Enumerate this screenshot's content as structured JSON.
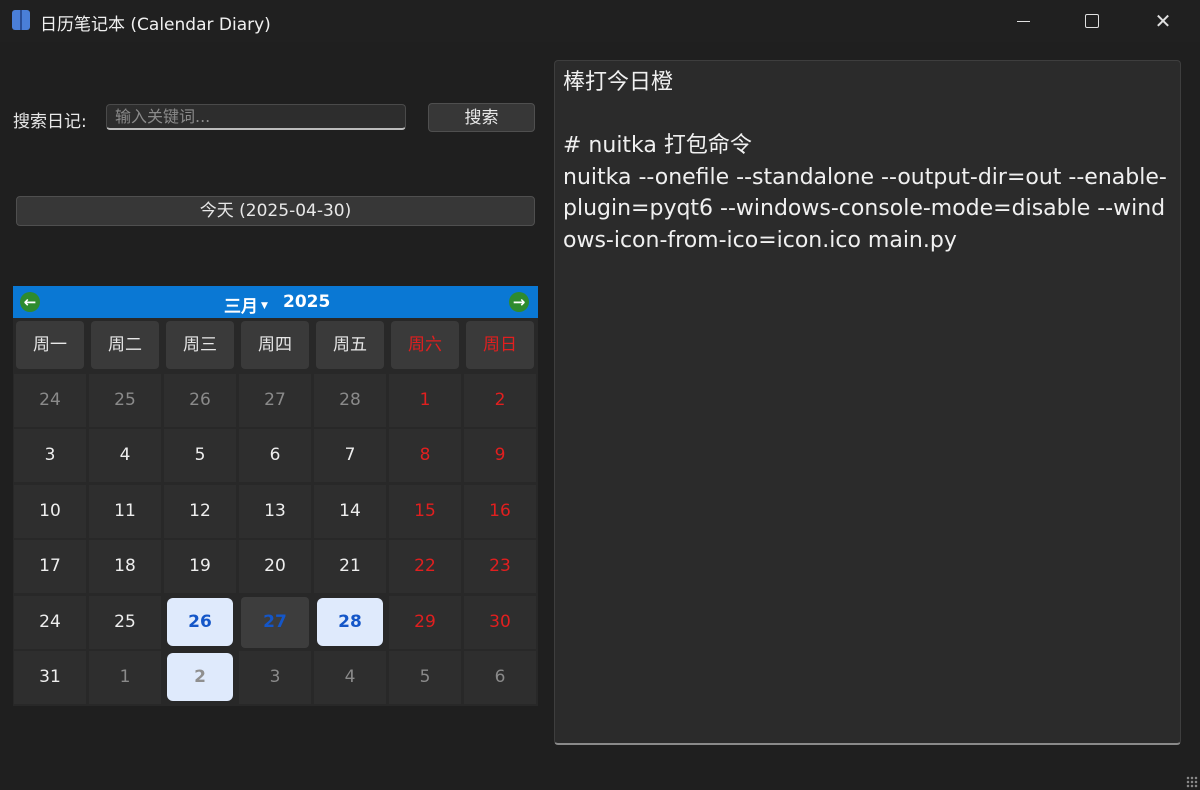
{
  "window": {
    "title": "日历笔记本 (Calendar Diary)",
    "icon": "book-icon",
    "controls": {
      "minimize": "minimize-icon",
      "maximize": "maximize-icon",
      "close": "✕"
    }
  },
  "search": {
    "label": "搜索日记:",
    "placeholder": "输入关键词...",
    "value": "",
    "button_label": "搜索"
  },
  "today_button": "今天 (2025-04-30)",
  "calendar": {
    "month": "三月",
    "year": "2025",
    "prev_icon": "←",
    "next_icon": "→",
    "weekdays": [
      "周一",
      "周二",
      "周三",
      "周四",
      "周五",
      "周六",
      "周日"
    ],
    "weeks": [
      [
        {
          "d": "24",
          "s": "other"
        },
        {
          "d": "25",
          "s": "other"
        },
        {
          "d": "26",
          "s": "other"
        },
        {
          "d": "27",
          "s": "other"
        },
        {
          "d": "28",
          "s": "other"
        },
        {
          "d": "1",
          "s": "weekend"
        },
        {
          "d": "2",
          "s": "weekend"
        }
      ],
      [
        {
          "d": "3",
          "s": ""
        },
        {
          "d": "4",
          "s": ""
        },
        {
          "d": "5",
          "s": ""
        },
        {
          "d": "6",
          "s": ""
        },
        {
          "d": "7",
          "s": ""
        },
        {
          "d": "8",
          "s": "weekend"
        },
        {
          "d": "9",
          "s": "weekend"
        }
      ],
      [
        {
          "d": "10",
          "s": ""
        },
        {
          "d": "11",
          "s": ""
        },
        {
          "d": "12",
          "s": ""
        },
        {
          "d": "13",
          "s": ""
        },
        {
          "d": "14",
          "s": ""
        },
        {
          "d": "15",
          "s": "weekend"
        },
        {
          "d": "16",
          "s": "weekend"
        }
      ],
      [
        {
          "d": "17",
          "s": ""
        },
        {
          "d": "18",
          "s": ""
        },
        {
          "d": "19",
          "s": ""
        },
        {
          "d": "20",
          "s": ""
        },
        {
          "d": "21",
          "s": ""
        },
        {
          "d": "22",
          "s": "weekend"
        },
        {
          "d": "23",
          "s": "weekend"
        }
      ],
      [
        {
          "d": "24",
          "s": ""
        },
        {
          "d": "25",
          "s": ""
        },
        {
          "d": "26",
          "s": "note"
        },
        {
          "d": "27",
          "s": "today"
        },
        {
          "d": "28",
          "s": "note"
        },
        {
          "d": "29",
          "s": "weekend"
        },
        {
          "d": "30",
          "s": "weekend"
        }
      ],
      [
        {
          "d": "31",
          "s": ""
        },
        {
          "d": "1",
          "s": "other"
        },
        {
          "d": "2",
          "s": "note other"
        },
        {
          "d": "3",
          "s": "other"
        },
        {
          "d": "4",
          "s": "other"
        },
        {
          "d": "5",
          "s": "other"
        },
        {
          "d": "6",
          "s": "other"
        }
      ]
    ]
  },
  "editor": {
    "text": "棒打今日橙\n\n# nuitka 打包命令\nnuitka --onefile --standalone --output-dir=out --enable-plugin=pyqt6 --windows-console-mode=disable --windows-icon-from-ico=icon.ico main.py"
  },
  "colors": {
    "accent": "#0a78d4",
    "weekend": "#e11f1f",
    "note_bg": "#dfeafc",
    "note_text": "#1456c8"
  }
}
